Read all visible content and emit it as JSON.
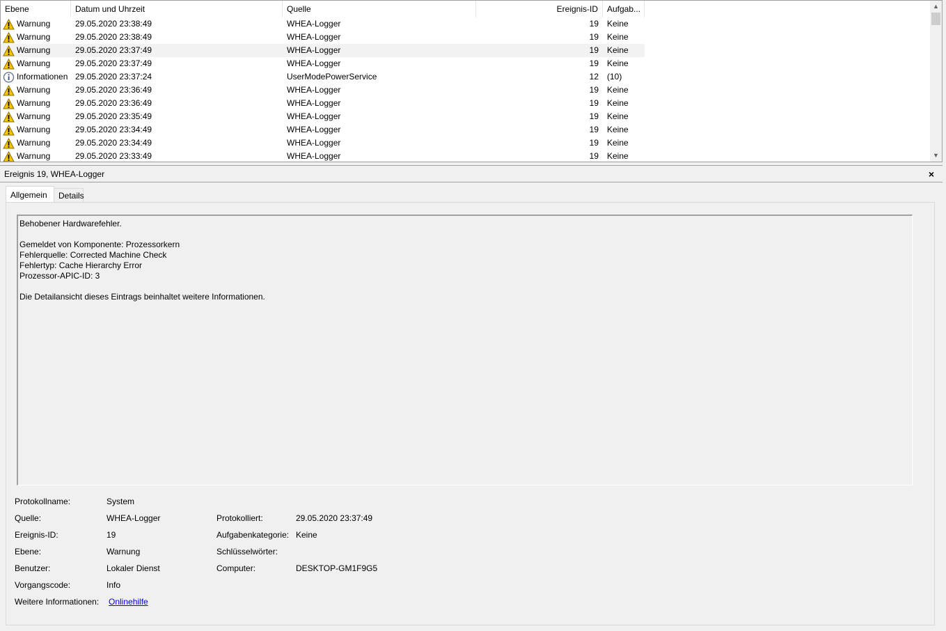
{
  "columns": {
    "level": "Ebene",
    "datetime": "Datum und Uhrzeit",
    "source": "Quelle",
    "event_id": "Ereignis-ID",
    "task": "Aufgab..."
  },
  "events": [
    {
      "level": "Warnung",
      "icon": "warning-icon",
      "datetime": "29.05.2020 23:38:49",
      "source": "WHEA-Logger",
      "event_id": "19",
      "task": "Keine"
    },
    {
      "level": "Warnung",
      "icon": "warning-icon",
      "datetime": "29.05.2020 23:38:49",
      "source": "WHEA-Logger",
      "event_id": "19",
      "task": "Keine"
    },
    {
      "level": "Warnung",
      "icon": "warning-icon",
      "datetime": "29.05.2020 23:37:49",
      "source": "WHEA-Logger",
      "event_id": "19",
      "task": "Keine",
      "selected": true
    },
    {
      "level": "Warnung",
      "icon": "warning-icon",
      "datetime": "29.05.2020 23:37:49",
      "source": "WHEA-Logger",
      "event_id": "19",
      "task": "Keine"
    },
    {
      "level": "Informationen",
      "icon": "info-icon",
      "datetime": "29.05.2020 23:37:24",
      "source": "UserModePowerService",
      "event_id": "12",
      "task": "(10)"
    },
    {
      "level": "Warnung",
      "icon": "warning-icon",
      "datetime": "29.05.2020 23:36:49",
      "source": "WHEA-Logger",
      "event_id": "19",
      "task": "Keine"
    },
    {
      "level": "Warnung",
      "icon": "warning-icon",
      "datetime": "29.05.2020 23:36:49",
      "source": "WHEA-Logger",
      "event_id": "19",
      "task": "Keine"
    },
    {
      "level": "Warnung",
      "icon": "warning-icon",
      "datetime": "29.05.2020 23:35:49",
      "source": "WHEA-Logger",
      "event_id": "19",
      "task": "Keine"
    },
    {
      "level": "Warnung",
      "icon": "warning-icon",
      "datetime": "29.05.2020 23:34:49",
      "source": "WHEA-Logger",
      "event_id": "19",
      "task": "Keine"
    },
    {
      "level": "Warnung",
      "icon": "warning-icon",
      "datetime": "29.05.2020 23:34:49",
      "source": "WHEA-Logger",
      "event_id": "19",
      "task": "Keine"
    },
    {
      "level": "Warnung",
      "icon": "warning-icon",
      "datetime": "29.05.2020 23:33:49",
      "source": "WHEA-Logger",
      "event_id": "19",
      "task": "Keine"
    }
  ],
  "detail": {
    "title": "Ereignis 19, WHEA-Logger",
    "close": "×",
    "tabs": [
      "Allgemein",
      "Details"
    ],
    "message": [
      "Behobener Hardwarefehler.",
      "",
      "Gemeldet von Komponente: Prozessorkern",
      "Fehlerquelle: Corrected Machine Check",
      "Fehlertyp: Cache Hierarchy Error",
      "Prozessor-APIC-ID: 3",
      "",
      "Die Detailansicht dieses Eintrags beinhaltet weitere Informationen."
    ],
    "props_left": [
      {
        "label": "Protokollname:",
        "value": "System"
      },
      {
        "label": "Quelle:",
        "value": "WHEA-Logger"
      },
      {
        "label": "Ereignis-ID:",
        "value": "19"
      },
      {
        "label": "Ebene:",
        "value": "Warnung"
      },
      {
        "label": "Benutzer:",
        "value": "Lokaler Dienst"
      },
      {
        "label": "Vorgangscode:",
        "value": "Info"
      },
      {
        "label": "Weitere Informationen:",
        "value": "Onlinehilfe"
      }
    ],
    "props_right": [
      {
        "label": "Protokolliert:",
        "value": "29.05.2020 23:37:49"
      },
      {
        "label": "Aufgabenkategorie:",
        "value": "Keine"
      },
      {
        "label": "Schlüsselwörter:",
        "value": ""
      },
      {
        "label": "Computer:",
        "value": "DESKTOP-GM1F9G5"
      }
    ]
  },
  "colors": {
    "warning": "#f7c600",
    "info": "#5a6e8c",
    "selection": "#f2f2f2",
    "link": "#0000ee"
  }
}
